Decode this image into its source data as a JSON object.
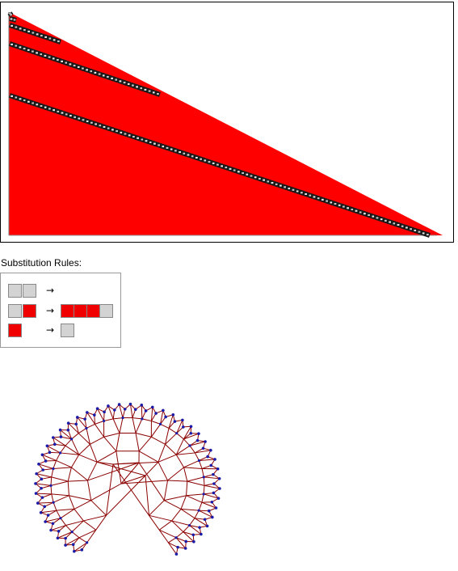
{
  "rules": {
    "heading": "Substitution Rules:",
    "arrow_glyph": "→",
    "items": [
      {
        "lhs": [
          "empty",
          "empty"
        ],
        "rhs": []
      },
      {
        "lhs": [
          "empty",
          "filled"
        ],
        "rhs": [
          "filled",
          "filled",
          "filled",
          "empty"
        ]
      },
      {
        "lhs": [
          "filled"
        ],
        "rhs": [
          "empty"
        ]
      }
    ]
  },
  "colors": {
    "filled": "#f00000",
    "empty": "#d3d3d3",
    "cell_border": "#888888",
    "frame": "#000000",
    "graph_edge": "#8b0000",
    "graph_vertex": "#1a1aa8"
  },
  "evolution": {
    "region_color": "#ff0000",
    "highlighted_steps": 4
  },
  "causal_graph": {
    "shape": "horseshoe"
  }
}
